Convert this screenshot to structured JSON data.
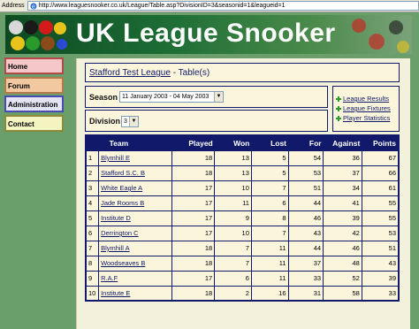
{
  "browser": {
    "address_label": "Address",
    "url": "http://www.leaguesnooker.co.uk/League/Table.asp?DivisionID=3&seasonid=1&leagueid=1"
  },
  "banner": {
    "title": "UK League Snooker"
  },
  "nav": {
    "items": [
      {
        "label": "Home"
      },
      {
        "label": "Forum"
      },
      {
        "label": "Administration"
      },
      {
        "label": "Contact"
      }
    ]
  },
  "header": {
    "league_link": "Stafford Test League",
    "suffix": " - Table(s)"
  },
  "season": {
    "label": "Season",
    "selected": "11 January 2003 - 04 May 2003"
  },
  "division": {
    "label": "Division",
    "selected": "3"
  },
  "links": [
    {
      "label": "League Results"
    },
    {
      "label": "League Fixtures"
    },
    {
      "label": "Player Statistics"
    }
  ],
  "table": {
    "headers": [
      "",
      "Team",
      "Played",
      "Won",
      "Lost",
      "For",
      "Against",
      "Points"
    ],
    "rows": [
      {
        "rank": "1",
        "team": "Blymhill E",
        "played": "18",
        "won": "13",
        "lost": "5",
        "for": "54",
        "against": "36",
        "points": "67"
      },
      {
        "rank": "2",
        "team": "Stafford S.C. B",
        "played": "18",
        "won": "13",
        "lost": "5",
        "for": "53",
        "against": "37",
        "points": "66"
      },
      {
        "rank": "3",
        "team": "White Eagle A",
        "played": "17",
        "won": "10",
        "lost": "7",
        "for": "51",
        "against": "34",
        "points": "61"
      },
      {
        "rank": "4",
        "team": "Jade Rooms B",
        "played": "17",
        "won": "11",
        "lost": "6",
        "for": "44",
        "against": "41",
        "points": "55"
      },
      {
        "rank": "5",
        "team": "Institute D",
        "played": "17",
        "won": "9",
        "lost": "8",
        "for": "46",
        "against": "39",
        "points": "55"
      },
      {
        "rank": "6",
        "team": "Derrington C",
        "played": "17",
        "won": "10",
        "lost": "7",
        "for": "43",
        "against": "42",
        "points": "53"
      },
      {
        "rank": "7",
        "team": "Blymhill A",
        "played": "18",
        "won": "7",
        "lost": "11",
        "for": "44",
        "against": "46",
        "points": "51"
      },
      {
        "rank": "8",
        "team": "Woodseaves B",
        "played": "18",
        "won": "7",
        "lost": "11",
        "for": "37",
        "against": "48",
        "points": "43"
      },
      {
        "rank": "9",
        "team": "R.A.F",
        "played": "17",
        "won": "6",
        "lost": "11",
        "for": "33",
        "against": "52",
        "points": "39"
      },
      {
        "rank": "10",
        "team": "Institute E",
        "played": "18",
        "won": "2",
        "lost": "16",
        "for": "31",
        "against": "58",
        "points": "33"
      }
    ]
  }
}
